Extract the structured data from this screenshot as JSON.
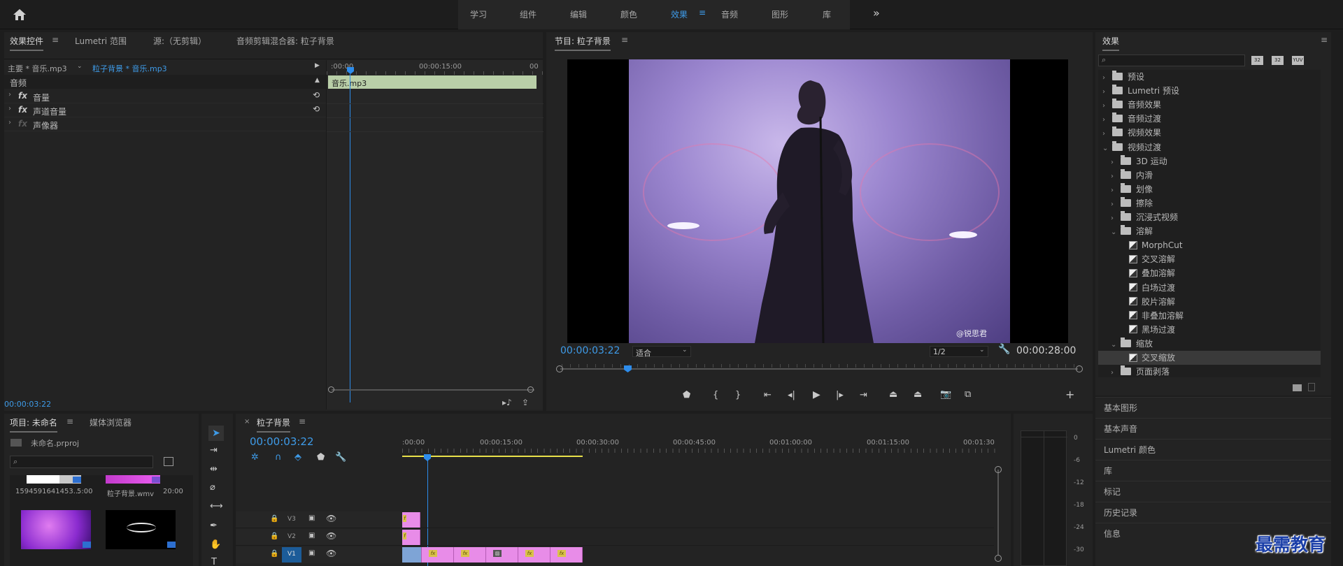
{
  "topnav": {
    "items": [
      "学习",
      "组件",
      "编辑",
      "颜色",
      "效果",
      "音频",
      "图形",
      "库"
    ],
    "active": "效果",
    "more": "»"
  },
  "effect_controls": {
    "tabs": [
      "效果控件",
      "Lumetri 范围",
      "源:（无剪辑）",
      "音频剪辑混合器: 粒子背景"
    ],
    "master": "主要 * 音乐.mp3",
    "sequence_clip": "粒子背景 * 音乐.mp3",
    "section": "音频",
    "rows": [
      "音量",
      "声道音量",
      "声像器"
    ],
    "ruler": [
      ":00:00",
      "00:00:15:00",
      "00"
    ],
    "clip": "音乐.mp3",
    "timecode": "00:00:03:22"
  },
  "program": {
    "title": "节目: 粒子背景",
    "timecode": "00:00:03:22",
    "fit": "适合",
    "resolution": "1/2",
    "duration": "00:00:28:00",
    "watermark": "@锐思君"
  },
  "effects": {
    "title": "效果",
    "search_placeholder": "",
    "filter_icons": [
      "32",
      "32",
      "YUV"
    ],
    "tree": [
      {
        "label": "预设",
        "level": 0,
        "type": "folder",
        "open": false
      },
      {
        "label": "Lumetri 预设",
        "level": 0,
        "type": "folder",
        "open": false
      },
      {
        "label": "音频效果",
        "level": 0,
        "type": "folder",
        "open": false
      },
      {
        "label": "音频过渡",
        "level": 0,
        "type": "folder",
        "open": false
      },
      {
        "label": "视频效果",
        "level": 0,
        "type": "folder",
        "open": false
      },
      {
        "label": "视频过渡",
        "level": 0,
        "type": "folder",
        "open": true
      },
      {
        "label": "3D 运动",
        "level": 1,
        "type": "folder",
        "open": false
      },
      {
        "label": "内滑",
        "level": 1,
        "type": "folder",
        "open": false
      },
      {
        "label": "划像",
        "level": 1,
        "type": "folder",
        "open": false
      },
      {
        "label": "擦除",
        "level": 1,
        "type": "folder",
        "open": false
      },
      {
        "label": "沉浸式视频",
        "level": 1,
        "type": "folder",
        "open": false
      },
      {
        "label": "溶解",
        "level": 1,
        "type": "folder",
        "open": true
      },
      {
        "label": "MorphCut",
        "level": 2,
        "type": "item"
      },
      {
        "label": "交叉溶解",
        "level": 2,
        "type": "item"
      },
      {
        "label": "叠加溶解",
        "level": 2,
        "type": "item"
      },
      {
        "label": "白场过渡",
        "level": 2,
        "type": "item"
      },
      {
        "label": "胶片溶解",
        "level": 2,
        "type": "item"
      },
      {
        "label": "非叠加溶解",
        "level": 2,
        "type": "item"
      },
      {
        "label": "黑场过渡",
        "level": 2,
        "type": "item"
      },
      {
        "label": "缩放",
        "level": 1,
        "type": "folder",
        "open": true
      },
      {
        "label": "交叉缩放",
        "level": 2,
        "type": "item",
        "selected": true
      },
      {
        "label": "页面剥落",
        "level": 1,
        "type": "folder",
        "open": false
      }
    ]
  },
  "side_panels": [
    "基本图形",
    "基本声音",
    "Lumetri 颜色",
    "库",
    "标记",
    "历史记录",
    "信息"
  ],
  "project": {
    "tabs": [
      "项目: 未命名",
      "媒体浏览器"
    ],
    "file": "未命名.prproj",
    "items": [
      {
        "name": "1594591641453...",
        "dur": "5:00"
      },
      {
        "name": "粒子背景.wmv",
        "dur": "20:00"
      }
    ]
  },
  "timeline": {
    "tab": "粒子背景",
    "timecode": "00:00:03:22",
    "ruler": [
      ":00:00",
      "00:00:15:00",
      "00:00:30:00",
      "00:00:45:00",
      "00:01:00:00",
      "00:01:15:00",
      "00:01:30"
    ],
    "tracks": [
      "V3",
      "V2",
      "V1"
    ]
  },
  "meter": {
    "labels": [
      "0",
      "-6",
      "-12",
      "-18",
      "-24",
      "-30"
    ]
  },
  "brand": "最需教育",
  "colors": {
    "accent": "#3e9be8",
    "clip_pink": "#e88ce8",
    "audio_clip": "#b9cfa8",
    "fx_badge": "#d9c24a"
  }
}
